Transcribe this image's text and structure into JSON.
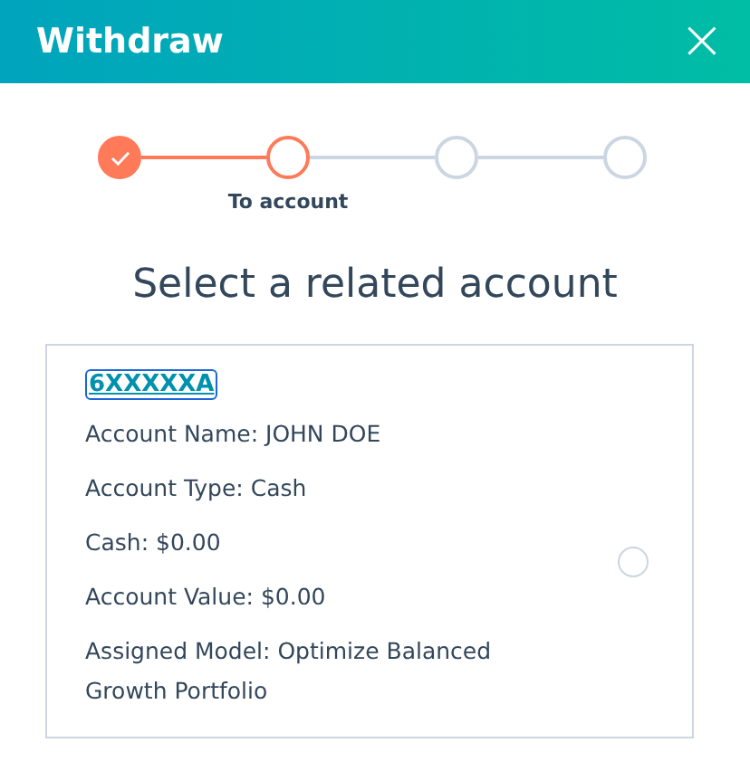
{
  "window": {
    "title": "Withdraw",
    "close": "×"
  },
  "steps": [
    {
      "kind": "done"
    },
    {
      "kind": "current",
      "label": "To account"
    },
    {
      "kind": "todo"
    },
    {
      "kind": "todo"
    }
  ],
  "heading": "Select a related account",
  "accounts": [
    {
      "number": "6XXXXXA",
      "selected": false,
      "details": [
        "Account Name: JOHN DOE",
        "Account Type: Cash",
        "Cash: $0.00",
        "Account Value: $0.00",
        "Assigned Model: Optimize Balanced Growth Portfolio"
      ]
    }
  ]
}
